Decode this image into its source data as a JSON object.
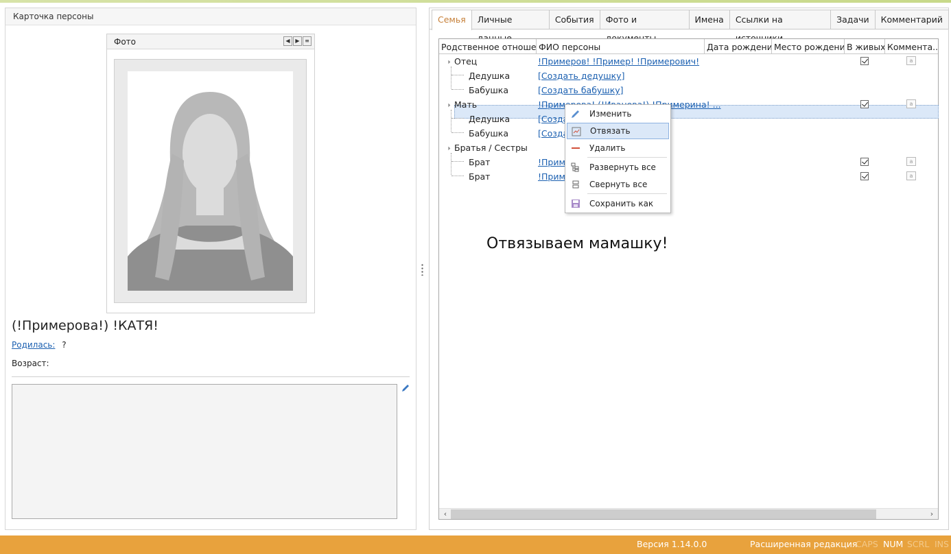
{
  "left": {
    "header": "Карточка персоны",
    "photo_title": "Фото",
    "person_name": "(!Примерова!) !КАТЯ!",
    "born_label": "Родилась:",
    "born_value": "?",
    "age_label": "Возраст:"
  },
  "tabs": [
    "Семья",
    "Личные данные",
    "События",
    "Фото и документы",
    "Имена",
    "Ссылки на источники",
    "Задачи",
    "Комментарий"
  ],
  "grid": {
    "columns": [
      "Родственное отноше...",
      "ФИО персоны",
      "Дата рождения",
      "Место рождения",
      "В живых",
      "Коммента..."
    ],
    "rows": [
      {
        "relation": "Отец",
        "name": "!Примеров! !Пример! !Примерович!",
        "alive": true,
        "comment": true
      },
      {
        "relation": "Дедушка",
        "name": "[Создать дедушку]"
      },
      {
        "relation": "Бабушка",
        "name": "[Создать бабушку]"
      },
      {
        "relation": "Мать",
        "name": "!Примерова! (!Иванова!) !Примерина! ...",
        "alive": true,
        "comment": true
      },
      {
        "relation": "Дедушка",
        "name": "[Созда"
      },
      {
        "relation": "Бабушка",
        "name": "[Созда"
      },
      {
        "relation": "Братья / Сестры",
        "name": ""
      },
      {
        "relation": "Брат",
        "name": "!Приме",
        "alive": true,
        "comment": true
      },
      {
        "relation": "Брат",
        "name": "!Приме",
        "alive": true,
        "comment": true
      }
    ]
  },
  "context_menu": [
    "Изменить",
    "Отвязать",
    "Удалить",
    "Развернуть все",
    "Свернуть все",
    "Сохранить как"
  ],
  "annotation": "Отвязываем мамашку!",
  "status": {
    "version": "Версия 1.14.0.0",
    "edition": "Расширенная редакция",
    "caps": "CAPS",
    "num": "NUM",
    "scrl": "SCRL",
    "ins": "INS"
  },
  "colors": {
    "accent": "#e8a23d",
    "active_tab": "#c7813a",
    "link": "#1a5fb0",
    "selection": "#dbe8f8"
  }
}
